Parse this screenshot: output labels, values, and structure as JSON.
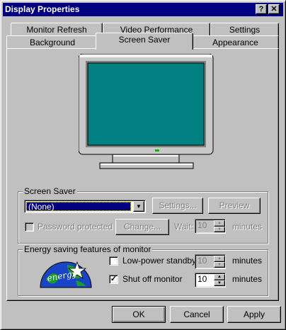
{
  "window": {
    "title": "Display Properties",
    "help_btn": "?",
    "close_btn": "✕"
  },
  "tabs": {
    "back_row": [
      "Monitor Refresh",
      "Video Performance",
      "Settings"
    ],
    "front_row": [
      "Background",
      "Screen Saver",
      "Appearance"
    ],
    "active": "Screen Saver"
  },
  "screen_saver": {
    "group_label": "Screen Saver",
    "selected": "(None)",
    "settings_btn": "Settings...",
    "preview_btn": "Preview",
    "password_label": "Password protected",
    "change_btn": "Change...",
    "wait_label": "Wait:",
    "wait_value": "10",
    "wait_unit": "minutes"
  },
  "energy": {
    "group_label": "Energy saving features of monitor",
    "low_power_label": "Low-power standby",
    "low_power_checked": false,
    "low_power_value": "10",
    "low_power_unit": "minutes",
    "shutoff_label": "Shut off monitor",
    "shutoff_checked": true,
    "shutoff_value": "10",
    "shutoff_unit": "minutes",
    "logo_text": "energy"
  },
  "buttons": {
    "ok": "OK",
    "cancel": "Cancel",
    "apply": "Apply"
  },
  "colors": {
    "title_bg": "#000080",
    "desktop": "#008080",
    "face": "#c0c0c0"
  }
}
